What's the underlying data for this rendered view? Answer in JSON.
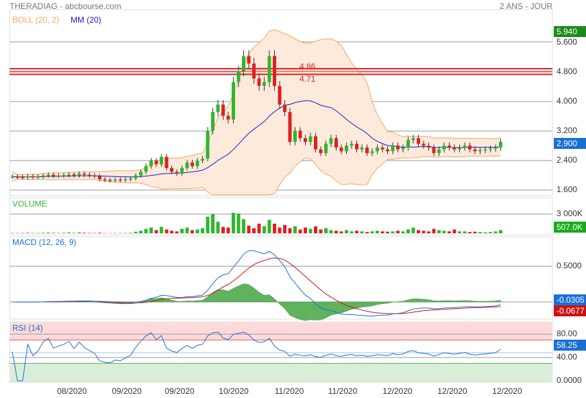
{
  "header": {
    "title": "THERADIAG - abcbourse.com",
    "period": "2 ANS - JOUR"
  },
  "legends": {
    "boll": "BOLL (20, 2)",
    "mm": "MM (20)",
    "volume": "VOLUME",
    "macd": "MACD (12, 26, 9)",
    "rsi": "RSI (14)"
  },
  "colors": {
    "up": "#2db82d",
    "down": "#e02020",
    "boll": "#f7a55a",
    "boll_fill": "#fdeadb",
    "mm": "#1a1acc",
    "macd": "#1a6fd6",
    "signal": "#cc1111",
    "hist": "#5fb35f"
  },
  "chart_data": [
    {
      "type": "candlestick",
      "title": "THERADIAG",
      "y_ticks": [
        "5.600",
        "4.800",
        "4.000",
        "3.200",
        "2.400",
        "1.600"
      ],
      "ylim": [
        1.5,
        6.0
      ],
      "closes": [
        1.97,
        1.96,
        1.95,
        1.98,
        1.96,
        1.97,
        2.0,
        2.02,
        1.99,
        2.0,
        2.01,
        2.03,
        2.0,
        2.05,
        2.02,
        2.0,
        1.98,
        1.9,
        1.88,
        1.87,
        1.89,
        1.88,
        1.9,
        1.92,
        2.0,
        2.1,
        2.25,
        2.4,
        2.3,
        2.5,
        2.2,
        2.1,
        2.05,
        2.2,
        2.35,
        2.25,
        2.4,
        2.45,
        3.2,
        3.7,
        3.9,
        3.6,
        3.5,
        4.5,
        4.8,
        5.2,
        5.0,
        4.6,
        4.4,
        4.5,
        5.2,
        4.4,
        3.9,
        3.7,
        2.9,
        3.2,
        3.0,
        2.9,
        3.05,
        2.7,
        2.6,
        2.85,
        3.0,
        2.75,
        2.65,
        2.8,
        2.85,
        2.7,
        2.75,
        2.6,
        2.65,
        2.75,
        2.7,
        2.65,
        2.8,
        2.7,
        2.75,
        2.95,
        3.0,
        2.85,
        2.8,
        2.75,
        2.6,
        2.7,
        2.8,
        2.75,
        2.7,
        2.75,
        2.8,
        2.7,
        2.65,
        2.68,
        2.7,
        2.72,
        2.75,
        2.9
      ],
      "last_high": "5.940",
      "last_price": "2.900",
      "levels": [
        {
          "value": 4.86,
          "label": "4.86"
        },
        {
          "value": 4.71,
          "label": "4.71"
        }
      ]
    },
    {
      "type": "bar",
      "title": "VOLUME",
      "y_ticks": [
        "3 000K"
      ],
      "last": "507.0K",
      "values": [
        60,
        40,
        50,
        80,
        40,
        60,
        90,
        120,
        70,
        60,
        80,
        130,
        60,
        150,
        90,
        60,
        50,
        90,
        40,
        30,
        50,
        40,
        60,
        80,
        250,
        400,
        700,
        900,
        500,
        1000,
        600,
        400,
        300,
        700,
        900,
        500,
        600,
        800,
        2600,
        3000,
        1800,
        1000,
        900,
        3200,
        3100,
        2200,
        1200,
        800,
        1500,
        1100,
        2100,
        1500,
        900,
        1300,
        800,
        1100,
        600,
        900,
        700,
        1100,
        600,
        800,
        500,
        400,
        300,
        500,
        300,
        400,
        300,
        200,
        300,
        400,
        300,
        250,
        300,
        400,
        300,
        600,
        900,
        500,
        400,
        300,
        700,
        500,
        400,
        300,
        600,
        300,
        300,
        200,
        250,
        200,
        150,
        200,
        300,
        507
      ]
    },
    {
      "type": "line",
      "title": "MACD (12, 26, 9)",
      "y_ticks": [
        "0.5000"
      ],
      "macd_last": "-0.0305",
      "signal_last": "-0.0677"
    },
    {
      "type": "line",
      "title": "RSI (14)",
      "y_ticks": [
        "80.00",
        "40.00",
        "0.0000"
      ],
      "last": "58.25"
    }
  ],
  "x_ticks": [
    "08/2020",
    "09/2020",
    "09/2020",
    "10/2020",
    "11/2020",
    "11/2020",
    "12/2020",
    "12/2020",
    "12/2020"
  ]
}
